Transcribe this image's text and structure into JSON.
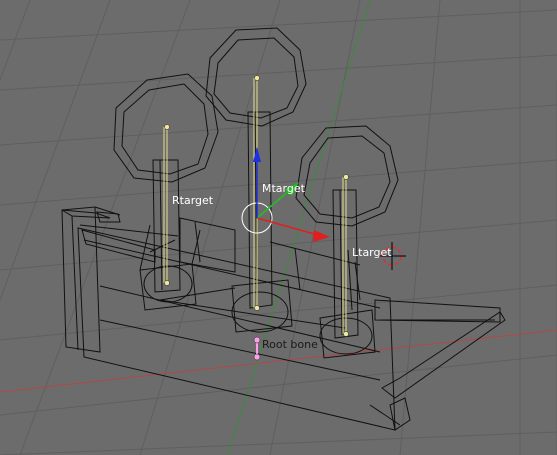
{
  "viewport": {
    "background": "#6c6c6c",
    "grid_color": "#5e5e5e",
    "wire_color": "#000000",
    "bone_color": "#e8e08a",
    "x_axis_color": "#b04848",
    "y_axis_color": "#3e8a3e"
  },
  "labels": {
    "rtarget": "Rtarget",
    "mtarget": "Mtarget",
    "ltarget": "Ltarget",
    "root_bone": "Root bone"
  },
  "manipulator": {
    "x_color": "#e02020",
    "y_color": "#20c020",
    "z_color": "#2030e0",
    "ring_color": "#ffffff"
  },
  "cursor": {
    "ring_color": "#e03030",
    "cross_color": "#000000"
  }
}
